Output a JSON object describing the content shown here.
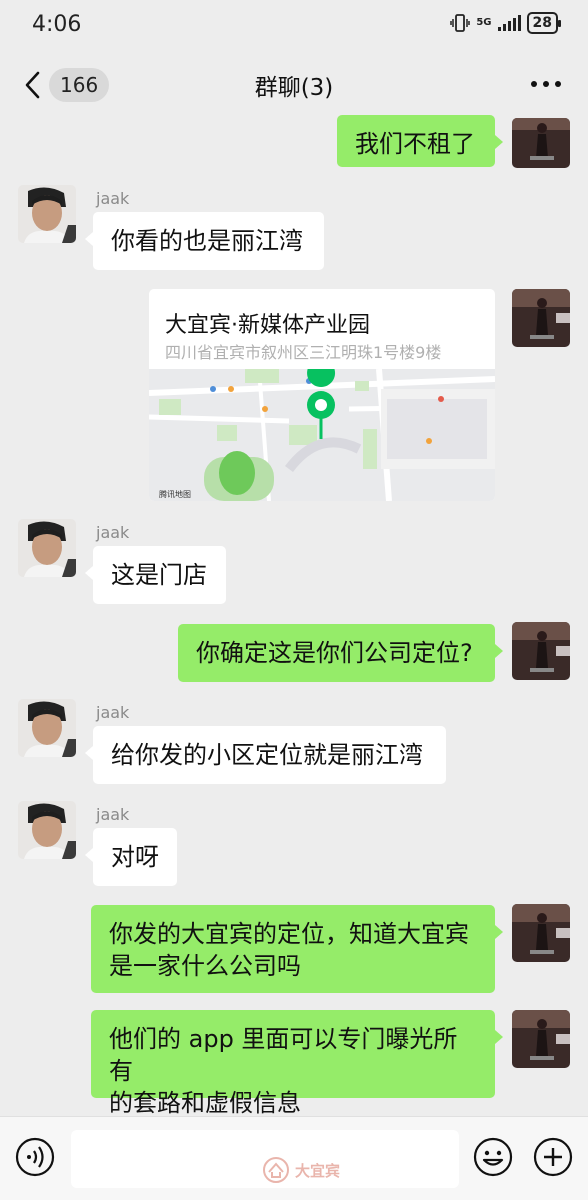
{
  "status_bar": {
    "time": "4:06",
    "network": "5G",
    "battery": "28"
  },
  "header": {
    "unread_count": "166",
    "title": "群聊(3)"
  },
  "messages": [
    {
      "side": "right",
      "text": "我们不租了"
    },
    {
      "side": "left",
      "sender": "jaak",
      "text": "你看的也是丽江湾"
    },
    {
      "side": "right",
      "type": "location",
      "name": "大宜宾·新媒体产业园",
      "address": "四川省宜宾市叙州区三江明珠1号楼9楼",
      "map_provider": "腾讯地图"
    },
    {
      "side": "left",
      "sender": "jaak",
      "text": "这是门店"
    },
    {
      "side": "right",
      "text": "你确定这是你们公司定位?"
    },
    {
      "side": "left",
      "sender": "jaak",
      "text": "给你发的小区定位就是丽江湾"
    },
    {
      "side": "left",
      "sender": "jaak",
      "text": "对呀"
    },
    {
      "side": "right",
      "text": "你发的大宜宾的定位，知道大宜宾\n是一家什么公司吗"
    },
    {
      "side": "right",
      "text": "他们的 app 里面可以专门曝光所有\n的套路和虚假信息"
    }
  ],
  "watermark": {
    "text": "大宜宾"
  },
  "colors": {
    "background": "#ededed",
    "self_bubble": "#95ec69",
    "other_bubble": "#ffffff",
    "map_pin": "#07c160"
  },
  "icons": [
    "back-icon",
    "more-icon",
    "voice-icon",
    "emoji-icon",
    "plus-icon",
    "map-pin-icon"
  ]
}
